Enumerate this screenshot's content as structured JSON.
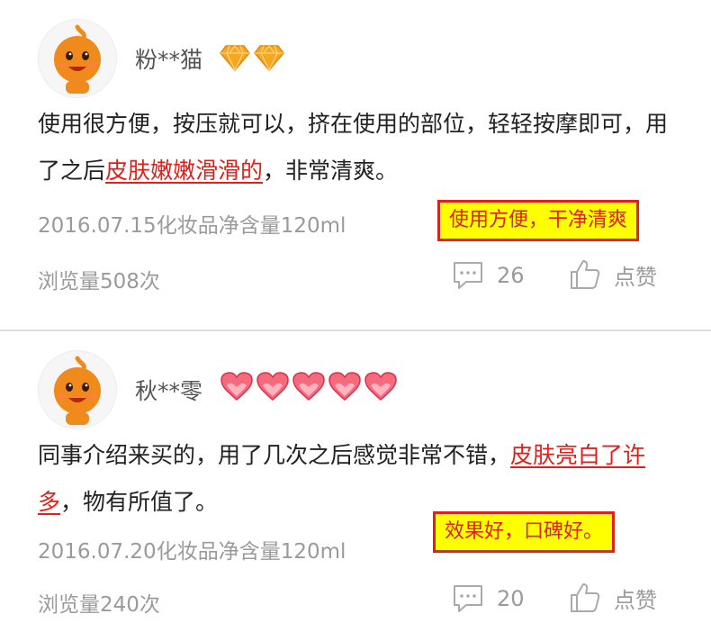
{
  "reviews": [
    {
      "username": "粉**猫",
      "badge_type": "diamond",
      "badge_count": 2,
      "content_before": "使用很方便，按压就可以，挤在使用的部位，轻轻按摩即可，用了之后",
      "content_highlight": "皮肤嫩嫩滑滑的",
      "content_after": "，非常清爽。",
      "meta": "2016.07.15化妆品净含量120ml",
      "views": "浏览量508次",
      "comment_count": "26",
      "like_label": "点赞",
      "note": "使用方便，干净清爽"
    },
    {
      "username": "秋**零",
      "badge_type": "heart",
      "badge_count": 5,
      "content_before": "同事介绍来买的，用了几次之后感觉非常不错，",
      "content_highlight": "皮肤亮白了许多",
      "content_after": "，物有所值了。",
      "meta": "2016.07.20化妆品净含量120ml",
      "views": "浏览量240次",
      "comment_count": "20",
      "like_label": "点赞",
      "note": "效果好，口碑好。"
    }
  ],
  "colors": {
    "highlight": "#e0201a",
    "note_bg": "#ffff00",
    "meta_text": "#9a9a9a",
    "avatar_orange": "#f08a1c"
  },
  "icons": {
    "avatar": "orange-mascot-avatar",
    "badge_diamond": "gold-diamond-icon",
    "badge_heart": "red-heart-icon",
    "comment": "comment-bubble-icon",
    "like": "thumbs-up-icon"
  }
}
